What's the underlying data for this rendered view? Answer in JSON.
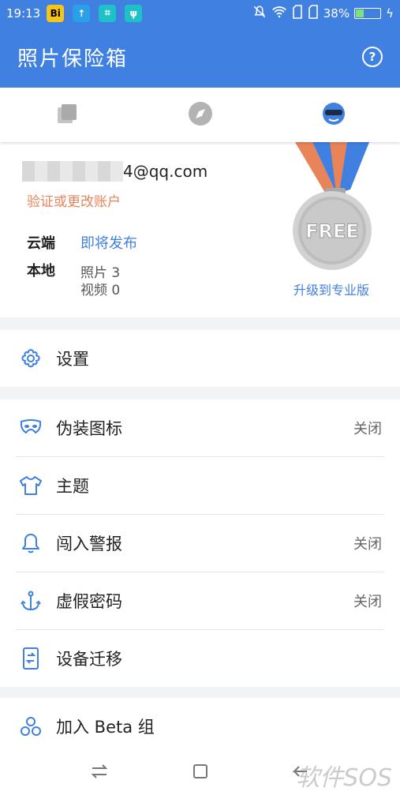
{
  "status_bar": {
    "time": "19:13",
    "battery": "38%",
    "battery_level": 0.38
  },
  "app_bar": {
    "title": "照片保险箱",
    "help_icon": "help-circle-icon"
  },
  "tabs": [
    {
      "icon": "photos-stack-icon",
      "selected": false
    },
    {
      "icon": "compass-icon",
      "selected": false
    },
    {
      "icon": "profile-spy-icon",
      "selected": true
    }
  ],
  "account": {
    "email_suffix": "4@qq.com",
    "verify_link": "验证或更改账户",
    "cloud_label": "云端",
    "cloud_value": "即将发布",
    "local_label": "本地",
    "photos": "照片 3",
    "videos": "视频 0",
    "medal_text": "FREE",
    "upgrade_link": "升级到专业版"
  },
  "menu": {
    "settings": {
      "label": "设置",
      "icon": "gear-icon"
    },
    "disguise": {
      "label": "伪装图标",
      "status": "关闭",
      "icon": "mask-icon"
    },
    "theme": {
      "label": "主题",
      "icon": "tshirt-icon"
    },
    "intrusion": {
      "label": "闯入警报",
      "status": "关闭",
      "icon": "bell-icon"
    },
    "decoy": {
      "label": "虚假密码",
      "status": "关闭",
      "icon": "anchor-icon"
    },
    "migrate": {
      "label": "设备迁移",
      "icon": "phone-transfer-icon"
    },
    "beta": {
      "label": "加入 Beta 组",
      "icon": "community-icon"
    }
  },
  "watermark": "软件SOS",
  "colors": {
    "primary": "#3f80e0",
    "accent_orange": "#e8835a",
    "icon_blue": "#3f80e0"
  }
}
